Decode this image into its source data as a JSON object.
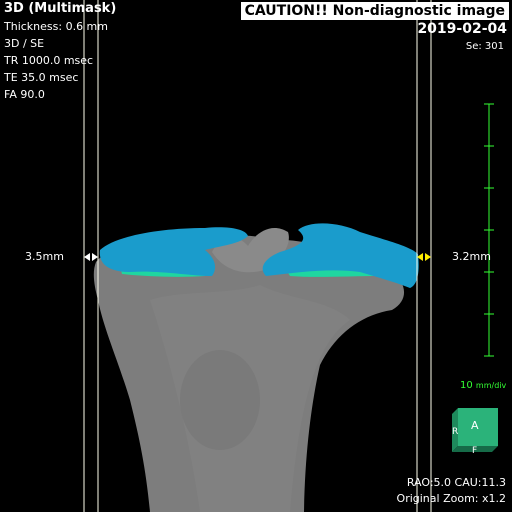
{
  "overlay": {
    "title": "3D (Multimask)",
    "thickness": "Thickness: 0.6 mm",
    "mode": "3D / SE",
    "tr": "TR 1000.0 msec",
    "te": "TE 35.0 msec",
    "fa": "FA 90.0"
  },
  "caution": "CAUTION!! Non-diagnostic image",
  "date": "2019-02-04",
  "series": "Se: 301",
  "measurements": {
    "left": "3.5mm",
    "right": "3.2mm"
  },
  "scale": {
    "value": "10",
    "unit": "mm/div"
  },
  "orientation_cube": {
    "front": "A",
    "side": "R",
    "bottom": "F"
  },
  "view": {
    "angles": "RAO:5.0 CAU:11.3",
    "zoom": "Original Zoom: x1.2"
  },
  "colors": {
    "bone": "#7d7d7d",
    "meniscus": "#1a9ccc",
    "cartilage": "#1fd6a0",
    "scale": "#33ff33",
    "cube": "#2bb37a",
    "guide_line": "#ffffee",
    "right_marker": "#ffee00"
  }
}
